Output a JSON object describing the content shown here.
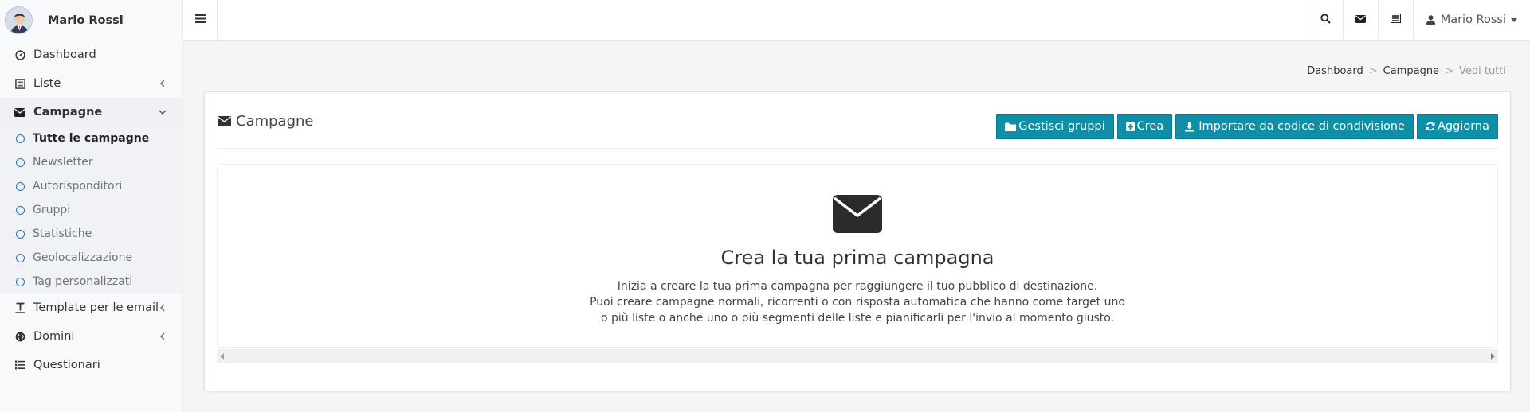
{
  "sidebar": {
    "user_name": "Mario Rossi",
    "items": [
      {
        "label": "Dashboard",
        "icon": "dashboard-icon"
      },
      {
        "label": "Liste",
        "icon": "list-icon"
      },
      {
        "label": "Campagne",
        "icon": "envelope-icon"
      },
      {
        "label": "Template per le email",
        "icon": "text-icon"
      },
      {
        "label": "Domini",
        "icon": "globe-icon"
      },
      {
        "label": "Questionari",
        "icon": "list-bullets-icon"
      }
    ],
    "campagne_sub": [
      {
        "label": "Tutte le campagne"
      },
      {
        "label": "Newsletter"
      },
      {
        "label": "Autorisponditori"
      },
      {
        "label": "Gruppi"
      },
      {
        "label": "Statistiche"
      },
      {
        "label": "Geolocalizzazione"
      },
      {
        "label": "Tag personalizzati"
      }
    ]
  },
  "topbar": {
    "user_name": "Mario Rossi"
  },
  "breadcrumb": {
    "items": [
      "Dashboard",
      "Campagne",
      "Vedi tutti"
    ]
  },
  "box": {
    "title": "Campagne",
    "buttons": {
      "groups": "Gestisci gruppi",
      "create": "Crea",
      "import": "Importare da codice di condivisione",
      "refresh": "Aggiorna"
    }
  },
  "empty": {
    "title": "Crea la tua prima campagna",
    "line1": "Inizia a creare la tua prima campagna per raggiungere il tuo pubblico di destinazione.",
    "line2": "Puoi creare campagne normali, ricorrenti o con risposta automatica che hanno come target uno",
    "line3": "o più liste o anche uno o più segmenti delle liste e pianificarli per l'invio al momento giusto."
  },
  "colors": {
    "accent": "#0e8fa8",
    "sub_ring": "#2e6fbd"
  }
}
